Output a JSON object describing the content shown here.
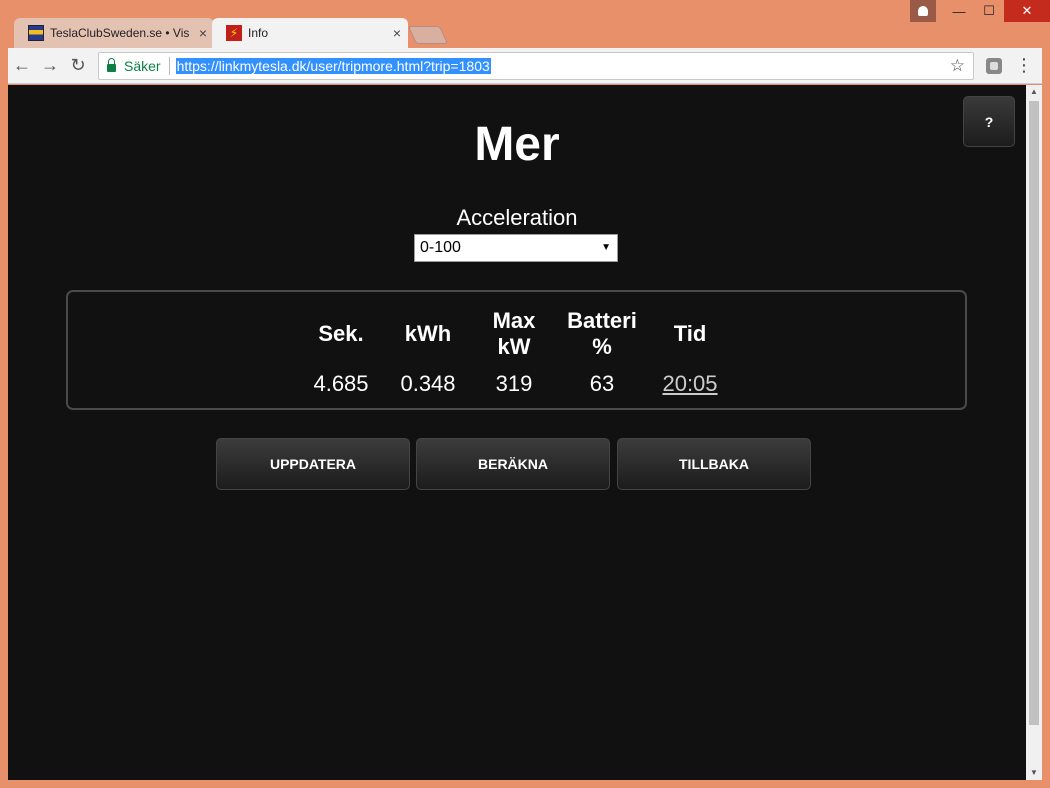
{
  "browser": {
    "tabs": [
      {
        "title": "TeslaClubSweden.se • Vis",
        "close": "×"
      },
      {
        "title": "Info",
        "close": "×"
      }
    ],
    "secure_label": "Säker",
    "url": "https://linkmytesla.dk/user/tripmore.html?trip=1803",
    "window_controls": {
      "minimize": "—",
      "maximize": "☐",
      "close": "✕"
    },
    "nav": {
      "back": "←",
      "forward": "→",
      "reload": "↻",
      "star": "☆",
      "menu": "⋮"
    }
  },
  "page": {
    "help_label": "?",
    "title": "Mer",
    "select_label": "Acceleration",
    "select_value": "0-100",
    "results": {
      "columns": [
        {
          "header": "Sek.",
          "value": "4.685"
        },
        {
          "header": "kWh",
          "value": "0.348"
        },
        {
          "header": "Max kW",
          "value": "319"
        },
        {
          "header": "Batteri %",
          "value": "63"
        },
        {
          "header": "Tid",
          "value": "20:05"
        }
      ]
    },
    "buttons": {
      "update": "UPPDATERA",
      "calculate": "BERÄKNA",
      "back": "TILLBAKA"
    }
  }
}
